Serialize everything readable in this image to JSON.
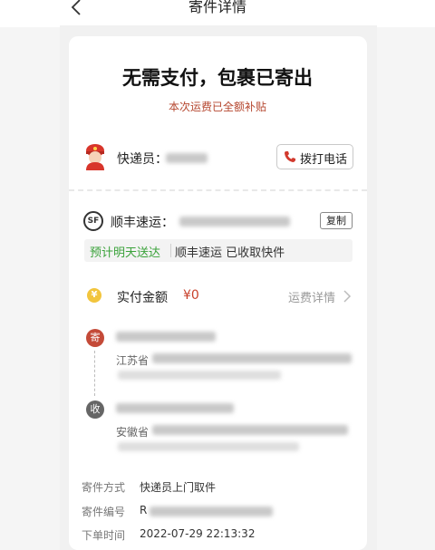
{
  "nav": {
    "title": "寄件详情",
    "back_icon": "chevron-left-icon"
  },
  "header": {
    "title": "无需支付，包裹已寄出",
    "subtitle": "本次运费已全额补贴"
  },
  "courier": {
    "label": "快递员：",
    "call_button": "拨打电话",
    "call_icon": "phone-icon"
  },
  "shipment": {
    "carrier_label": "顺丰速运：",
    "carrier_icon_text": "SF",
    "copy_button": "复制",
    "status_highlight": "预计明天送达",
    "status_text": "顺丰速运 已收取快件"
  },
  "payment": {
    "label": "实付金额",
    "amount": "¥0",
    "detail_link": "运费详情",
    "coin_icon_text": "¥"
  },
  "route": {
    "sender_icon_text": "寄",
    "sender_province": "江苏省",
    "receiver_icon_text": "收",
    "receiver_province": "安徽省"
  },
  "info": {
    "method_label": "寄件方式",
    "method_value": "快递员上门取件",
    "number_label": "寄件编号",
    "number_value": "R",
    "time_label": "下单时间",
    "time_value": "2022-07-29 22:13:32"
  },
  "colors": {
    "accent_red": "#c8412b",
    "status_green": "#3aa23a"
  }
}
